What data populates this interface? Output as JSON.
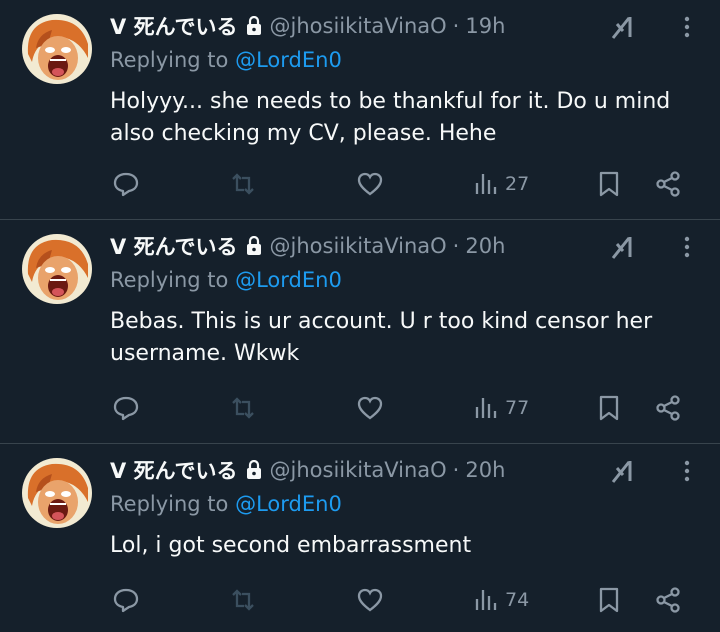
{
  "tweets": [
    {
      "display_name": "V 死んでいる",
      "handle": "@jhosiikitaVinaO",
      "separator": "·",
      "time": "19h",
      "replying_prefix": "Replying to",
      "replying_to": "@LordEn0",
      "text": "Holyyy... she needs to be thankful for it. Do u mind also checking my CV, please. Hehe",
      "views": "27"
    },
    {
      "display_name": "V 死んでいる",
      "handle": "@jhosiikitaVinaO",
      "separator": "·",
      "time": "20h",
      "replying_prefix": "Replying to",
      "replying_to": "@LordEn0",
      "text": "Bebas. This is ur account. U r too kind censor her username. Wkwk",
      "views": "77"
    },
    {
      "display_name": "V 死んでいる",
      "handle": "@jhosiikitaVinaO",
      "separator": "·",
      "time": "20h",
      "replying_prefix": "Replying to",
      "replying_to": "@LordEn0",
      "text": "Lol, i got second embarrassment",
      "views": "74"
    }
  ],
  "icons": {
    "lock": "lock-icon",
    "grok": "grok-icon",
    "more": "more-icon",
    "reply": "reply-icon",
    "retweet": "retweet-icon",
    "like": "heart-icon",
    "views": "views-icon",
    "bookmark": "bookmark-icon",
    "share": "share-icon"
  },
  "colors": {
    "background": "#15202b",
    "divider": "#38444d",
    "text": "#f7f9f9",
    "secondary": "#8b98a5",
    "mention": "#1d9bf0",
    "retweet_disabled": "#3b4f5f"
  }
}
